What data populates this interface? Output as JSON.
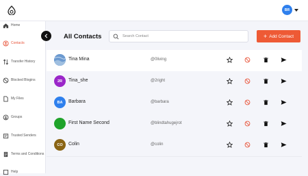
{
  "header": {
    "user_initials": "BR"
  },
  "sidebar": {
    "items": [
      {
        "label": "Home",
        "icon": "home-icon"
      },
      {
        "label": "Contacts",
        "icon": "contacts-icon",
        "active": true
      },
      {
        "label": "Transfer History",
        "icon": "transfer-icon"
      },
      {
        "label": "Blocked Blogins",
        "icon": "blocked-icon"
      },
      {
        "label": "My Files",
        "icon": "file-icon"
      },
      {
        "label": "Groups",
        "icon": "groups-icon"
      },
      {
        "label": "Trusted Senders",
        "icon": "trusted-icon"
      },
      {
        "label": "Terms and Conditions",
        "icon": "terms-icon"
      },
      {
        "label": "Help",
        "icon": "help-icon"
      }
    ]
  },
  "main": {
    "title": "All Contacts",
    "search_placeholder": "Search Contact",
    "add_button_label": "Add Contact"
  },
  "contacts": [
    {
      "name": "Tina Mina",
      "handle": "@0living",
      "initials": "",
      "color": "#5b8fc7",
      "photo": true
    },
    {
      "name": "Tina_she",
      "handle": "@2right",
      "initials": "2R",
      "color": "#9b27c9"
    },
    {
      "name": "Barbara",
      "handle": "@barbara",
      "initials": "BA",
      "color": "#2f80ed"
    },
    {
      "name": "First Name Second",
      "handle": "@blindtahugejrot",
      "initials": "",
      "color": "#1fa32a"
    },
    {
      "name": "Colin",
      "handle": "@colin",
      "initials": "CO",
      "color": "#8a6414"
    }
  ],
  "colors": {
    "accent": "#ee5a35",
    "block_icon": "#e8543a"
  }
}
